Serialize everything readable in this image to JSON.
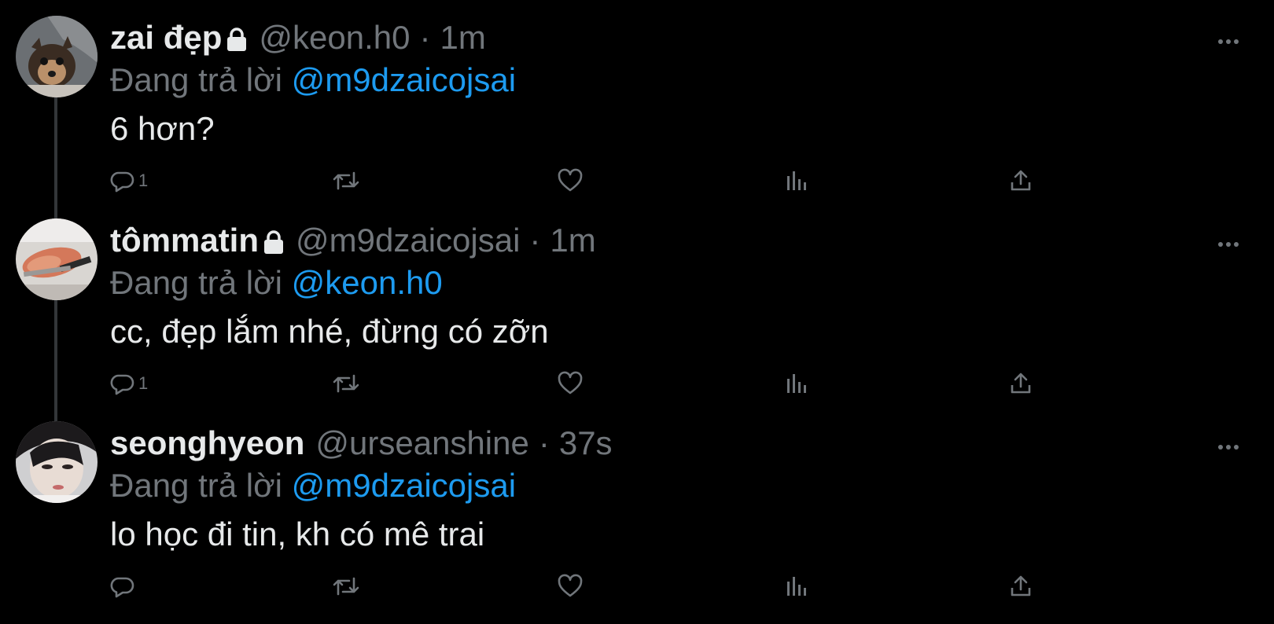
{
  "colors": {
    "background": "#000000",
    "text": "#e7e9ea",
    "muted": "#71767b",
    "accent": "#1d9bf0",
    "thread_line": "#333639"
  },
  "tweets": [
    {
      "display_name": "zai đẹp",
      "handle": "@keon.h0",
      "separator": "·",
      "time": "1m",
      "replying_prefix": "Đang trả lời",
      "replying_to": "@m9dzaicojsai",
      "text": "6 hơn?",
      "reply_count": "1",
      "protected": true,
      "avatar": "dog-photo-avatar"
    },
    {
      "display_name": "tômmatin",
      "handle": "@m9dzaicojsai",
      "separator": "·",
      "time": "1m",
      "replying_prefix": "Đang trả lời",
      "replying_to": "@keon.h0",
      "text": "cc, đẹp lắm nhé, đừng có zỡn",
      "reply_count": "1",
      "protected": true,
      "avatar": "shrimp-photo-avatar"
    },
    {
      "display_name": "seonghyeon",
      "handle": "@urseanshine",
      "separator": "·",
      "time": "37s",
      "replying_prefix": "Đang trả lời",
      "replying_to": "@m9dzaicojsai",
      "text": "lo học đi tin, kh có mê trai",
      "reply_count": "",
      "protected": false,
      "avatar": "person-photo-avatar"
    }
  ]
}
